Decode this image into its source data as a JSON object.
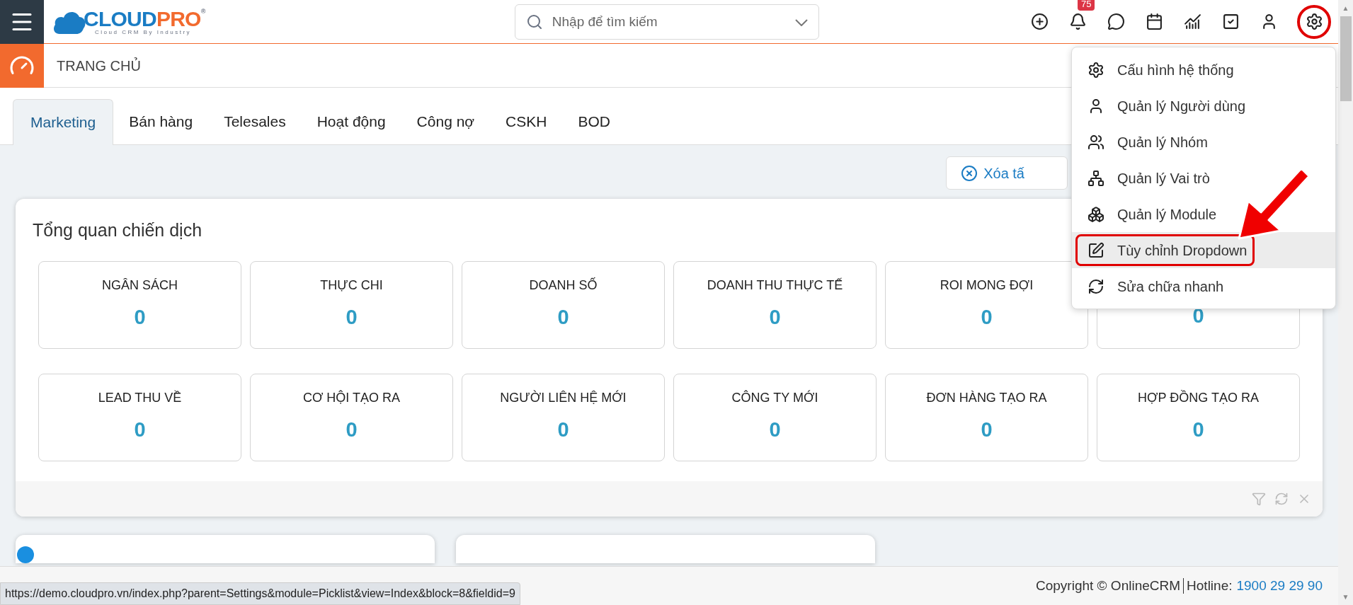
{
  "header": {
    "logo": {
      "brand_a": "CLOUD",
      "brand_b": "PRO",
      "mark": "®",
      "tagline": "Cloud CRM By Industry"
    },
    "search": {
      "placeholder": "Nhập để tìm kiếm"
    },
    "notification_count": "75"
  },
  "page_title": "TRANG CHỦ",
  "tabs": [
    {
      "label": "Marketing",
      "selected": true
    },
    {
      "label": "Bán hàng",
      "selected": false
    },
    {
      "label": "Telesales",
      "selected": false
    },
    {
      "label": "Hoạt động",
      "selected": false
    },
    {
      "label": "Công nợ",
      "selected": false
    },
    {
      "label": "CSKH",
      "selected": false
    },
    {
      "label": "BOD",
      "selected": false
    }
  ],
  "clear_button": "Xóa tấ",
  "overview": {
    "title": "Tổng quan chiến dịch",
    "metrics": [
      {
        "label": "NGÂN SÁCH",
        "value": "0"
      },
      {
        "label": "THỰC CHI",
        "value": "0"
      },
      {
        "label": "DOANH SỐ",
        "value": "0"
      },
      {
        "label": "DOANH THU THỰC TẾ",
        "value": "0"
      },
      {
        "label": "ROI MONG ĐỢI",
        "value": "0"
      },
      {
        "value": "0"
      },
      {
        "label": "LEAD THU VỀ",
        "value": "0"
      },
      {
        "label": "CƠ HỘI TẠO RA",
        "value": "0"
      },
      {
        "label": "NGƯỜI LIÊN HỆ MỚI",
        "value": "0"
      },
      {
        "label": "CÔNG TY MỚI",
        "value": "0"
      },
      {
        "label": "ĐƠN HÀNG TẠO RA",
        "value": "0"
      },
      {
        "label": "HỢP ĐỒNG TẠO RA",
        "value": "0"
      }
    ]
  },
  "settings_menu": {
    "items": [
      {
        "kind": "gear",
        "label": "Cấu hình hệ thống",
        "selected": false
      },
      {
        "kind": "user",
        "label": "Quản lý Người dùng",
        "selected": false
      },
      {
        "kind": "group",
        "label": "Quản lý Nhóm",
        "selected": false
      },
      {
        "kind": "hierarchy",
        "label": "Quản lý Vai trò",
        "selected": false
      },
      {
        "kind": "boxes",
        "label": "Quản lý Module",
        "selected": false
      },
      {
        "kind": "edit",
        "label": "Tùy chỉnh Dropdown",
        "selected": true
      },
      {
        "kind": "refresh",
        "label": "Sửa chữa nhanh",
        "selected": false
      }
    ]
  },
  "footer": {
    "copyright": "Copyright © OnlineCRM",
    "hotline_label": "Hotline:",
    "hotline": "1900 29 29 90"
  },
  "scrollbar": {
    "up": "▲",
    "down": "▼"
  },
  "status_url": "https://demo.cloudpro.vn/index.php?parent=Settings&module=Picklist&view=Index&block=8&fieldid=9"
}
